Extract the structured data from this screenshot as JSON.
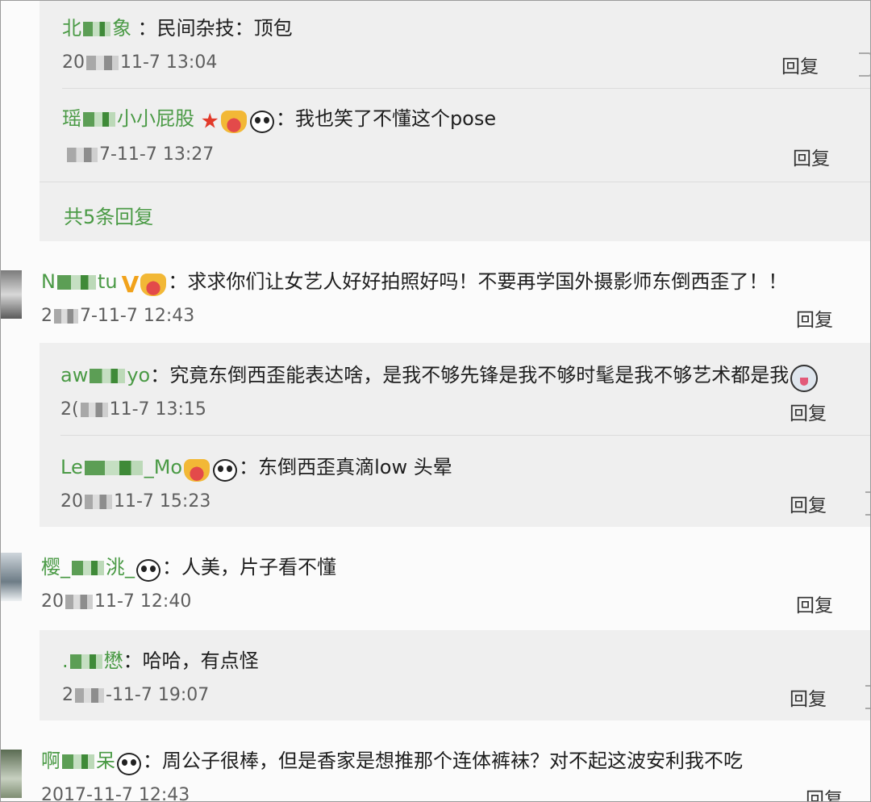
{
  "reply_label": "回复",
  "block1": {
    "reply1": {
      "name_pre": "北",
      "name_post": "象",
      "colon": "：",
      "text": "民间杂技：顶包",
      "time_pre": "20",
      "time_post": "11-7 13:04"
    },
    "reply2": {
      "name_pre": "瑶",
      "name_post": "小小屁股",
      "colon": "：",
      "text": "我也笑了不懂这个pose",
      "time_post": "7-11-7 13:27"
    },
    "more_replies": "共5条回复"
  },
  "comment1": {
    "name_pre": "N",
    "name_post": "tu",
    "v": "V",
    "colon": "：",
    "text": "求求你们让女艺人好好拍照好吗！不要再学国外摄影师东倒西歪了！！",
    "time_pre": "2",
    "time_post": "7-11-7 12:43",
    "replies": [
      {
        "name_pre": "aw",
        "name_post": "yo",
        "colon": "：",
        "text": "究竟东倒西歪能表达啥，是我不够先锋是我不够时髦是我不够艺术都是我",
        "time_pre": "2(",
        "time_post": "11-7 13:15"
      },
      {
        "name_pre": "Le",
        "name_post": "_Mo",
        "colon": "：",
        "text": "东倒西歪真滴low 头晕",
        "time_pre": "20",
        "time_post": "11-7 15:23"
      }
    ]
  },
  "comment2": {
    "name_pre": "樱_",
    "name_post": "洮_",
    "colon": "：",
    "text": "人美，片子看不懂",
    "time_pre": "20",
    "time_post": "11-7 12:40",
    "replies": [
      {
        "name_pre": ".",
        "name_post": "懋",
        "colon": "：",
        "text": "哈哈，有点怪",
        "time_pre": "2",
        "time_post": "-11-7 19:07"
      }
    ]
  },
  "comment3": {
    "name_pre": "啊",
    "name_post": "呆",
    "colon": "：",
    "text": "周公子很棒，但是香家是想推那个连体裤袜？对不起这波安利我不吃",
    "time": "2017-11-7 12:43"
  },
  "icons": {
    "panda": "panda-emoji-icon",
    "crown": "crown-heart-badge-icon",
    "star": "red-star-icon",
    "v": "verified-v-icon",
    "husky": "husky-emoji-icon",
    "thumb": "thumbs-up-icon"
  },
  "colors": {
    "username": "#4a9a45",
    "reply_bg": "#efefef",
    "page_bg": "#fbfbfb",
    "star": "#e23a2a",
    "v": "#f1a21b"
  }
}
